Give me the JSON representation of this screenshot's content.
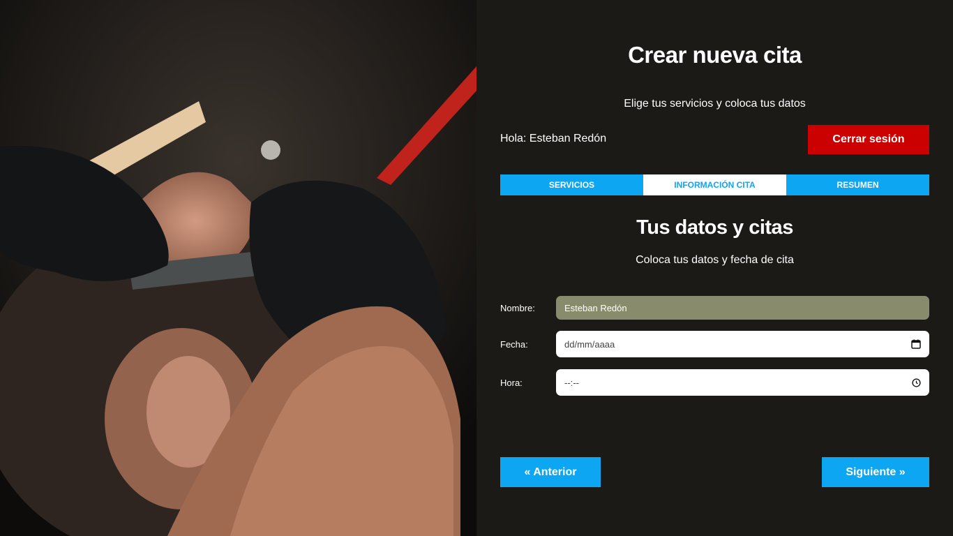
{
  "header": {
    "title": "Crear nueva cita",
    "subtitle": "Elige tus servicios y coloca tus datos"
  },
  "session": {
    "greeting": "Hola: Esteban Redón",
    "logout_label": "Cerrar sesión"
  },
  "tabs": [
    {
      "label": "SERVICIOS",
      "active": false
    },
    {
      "label": "INFORMACIÓN CITA",
      "active": true
    },
    {
      "label": "RESUMEN",
      "active": false
    }
  ],
  "section": {
    "title": "Tus datos y citas",
    "subtitle": "Coloca tus datos y fecha de cita"
  },
  "form": {
    "name_label": "Nombre:",
    "name_value": "Esteban Redón",
    "date_label": "Fecha:",
    "date_placeholder": "dd/mm/aaaa",
    "time_label": "Hora:",
    "time_placeholder": "--:--"
  },
  "navigation": {
    "prev_label": "« Anterior",
    "next_label": "Siguiente »"
  },
  "icons": {
    "date": "calendar-icon",
    "time": "clock-icon"
  },
  "colors": {
    "accent": "#0da6f3",
    "danger": "#cb0000",
    "background": "#1b1a17",
    "readonly_field": "#898c6c"
  }
}
